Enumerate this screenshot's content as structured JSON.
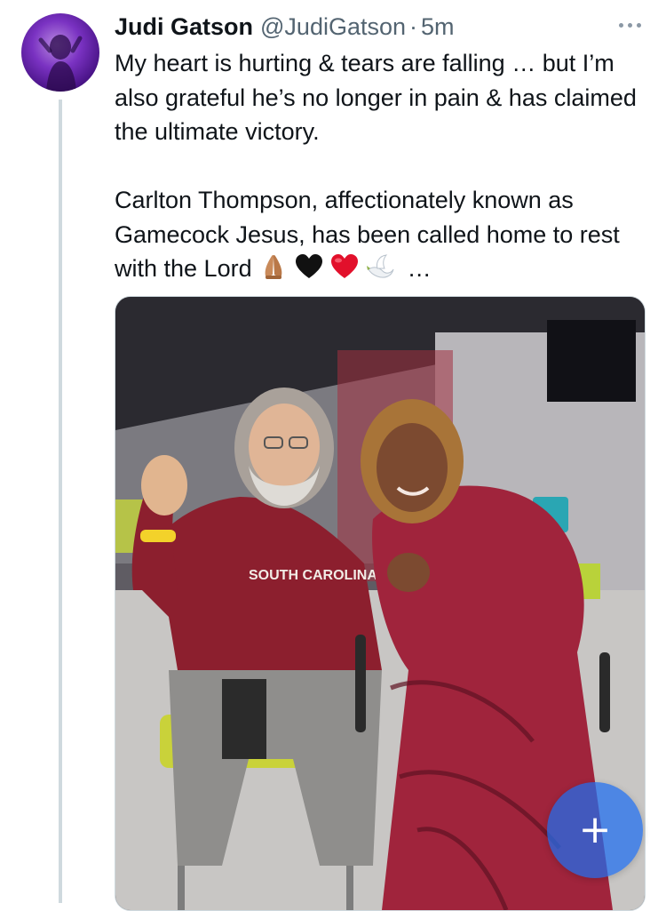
{
  "tweet": {
    "display_name": "Judi Gatson",
    "handle": "@JudiGatson",
    "separator": "·",
    "time": "5m",
    "paragraph1": "My heart is hurting & tears are falling … but I’m also grateful he’s no longer in pain & has claimed the ultimate victory.",
    "paragraph2": "Carlton Thompson, affectionately known as Gamecock Jesus, has been called home to rest with the Lord",
    "paragraph2_ellipsis": " …",
    "emojis": [
      "folded-hands-icon",
      "black-heart-icon",
      "red-heart-icon",
      "dove-icon"
    ]
  },
  "media": {
    "shirt_text": "SOUTH CAROLINA"
  },
  "compose_button": {
    "icon": "plus-icon",
    "glyph": "+"
  },
  "colors": {
    "text_primary": "#0f1419",
    "text_secondary": "#536471",
    "thread_line": "#cfd9de",
    "compose_blue": "#1d6ef0",
    "garnet": "#8c1f2e",
    "dress": "#a0243c"
  }
}
